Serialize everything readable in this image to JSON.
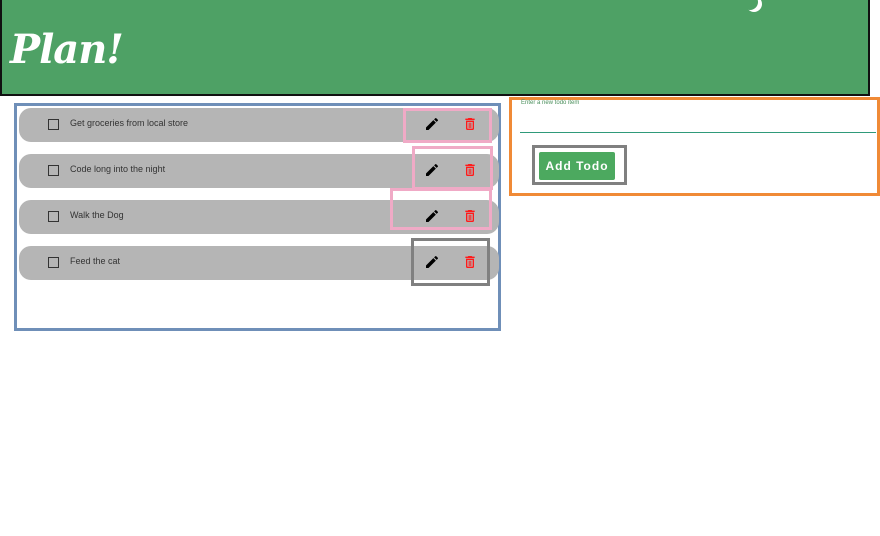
{
  "header": {
    "brand": "Plan!",
    "theme_icon": "moon-icon"
  },
  "todos": [
    {
      "text": "Get groceries from local store",
      "checked": false
    },
    {
      "text": "Code long into the night",
      "checked": false
    },
    {
      "text": "Walk the Dog",
      "checked": false
    },
    {
      "text": "Feed the cat",
      "checked": false
    }
  ],
  "icons": {
    "edit": "pencil-icon",
    "delete": "trash-icon"
  },
  "colors": {
    "header_bg": "#4ea165",
    "item_bg": "#b5b5b5",
    "delete_icon": "#ff1a1a",
    "button_bg": "#4ca95f"
  },
  "form": {
    "input_label": "Enter a new todo item",
    "input_value": "",
    "add_button_label": "Add Todo"
  }
}
